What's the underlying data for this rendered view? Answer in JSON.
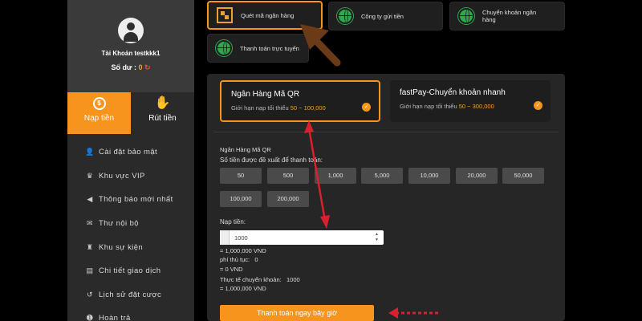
{
  "colors": {
    "accent": "#f7941d",
    "annotation": "#d8202f",
    "arrow_brown": "#6b3a16",
    "success": "#2fa84f"
  },
  "profile": {
    "account_label": "Tài Khoản testkkk1",
    "balance_label": "Số dư :",
    "balance_value": "0",
    "refresh_icon": "refresh-icon"
  },
  "tabs": [
    {
      "label": "Nạp tiền",
      "icon": "deposit-icon"
    },
    {
      "label": "Rút tiền",
      "icon": "withdraw-icon"
    }
  ],
  "menu": [
    {
      "label": "Cài đặt bảo mật",
      "icon": "user-lock-icon"
    },
    {
      "label": "Khu vực VIP",
      "icon": "crown-icon"
    },
    {
      "label": "Thông báo mới nhất",
      "icon": "megaphone-icon"
    },
    {
      "label": "Thư nội bộ",
      "icon": "mail-icon"
    },
    {
      "label": "Khu sự kiện",
      "icon": "trophy-icon"
    },
    {
      "label": "Chi tiết giao dịch",
      "icon": "document-icon"
    },
    {
      "label": "Lịch sử đặt cược",
      "icon": "history-icon"
    },
    {
      "label": "Hoàn trả",
      "icon": "refund-icon"
    }
  ],
  "methods": [
    {
      "label": "Quét mã ngân hàng",
      "icon": "qr-icon"
    },
    {
      "label": "Công ty gửi tiền",
      "icon": "globe-icon"
    },
    {
      "label": "Chuyển khoản ngân hàng",
      "icon": "globe-icon"
    },
    {
      "label": "Thanh toán trực tuyến",
      "icon": "globe-icon"
    }
  ],
  "banks": [
    {
      "title": "Ngân Hàng Mã QR",
      "limit_label": "Giới hạn nạp tối thiểu",
      "limit_range": "50 ~ 100,000"
    },
    {
      "title": "fastPay-Chuyển khoản nhanh",
      "limit_label": "Giới hạn nạp tối thiểu",
      "limit_range": "50 ~ 300,000"
    }
  ],
  "form": {
    "section_title": "Ngân Hàng Mã QR",
    "suggest_label": "Số tiền được đề xuất để thanh toán:",
    "amounts": [
      "50",
      "500",
      "1,000",
      "5,000",
      "10,000",
      "20,000",
      "50,000",
      "100,000",
      "200,000"
    ],
    "deposit_label": "Nạp tiền:",
    "input_value": "1000",
    "equiv": "= 1,000,000 VND",
    "fee_label": "phí thủ tục:",
    "fee_value": "0",
    "fee_equiv": "= 0 VND",
    "actual_label": "Thực tế chuyển khoản:",
    "actual_value": "1000",
    "actual_equiv": "= 1,000,000 VND",
    "pay_button": "Thanh toán ngay bây giờ"
  }
}
